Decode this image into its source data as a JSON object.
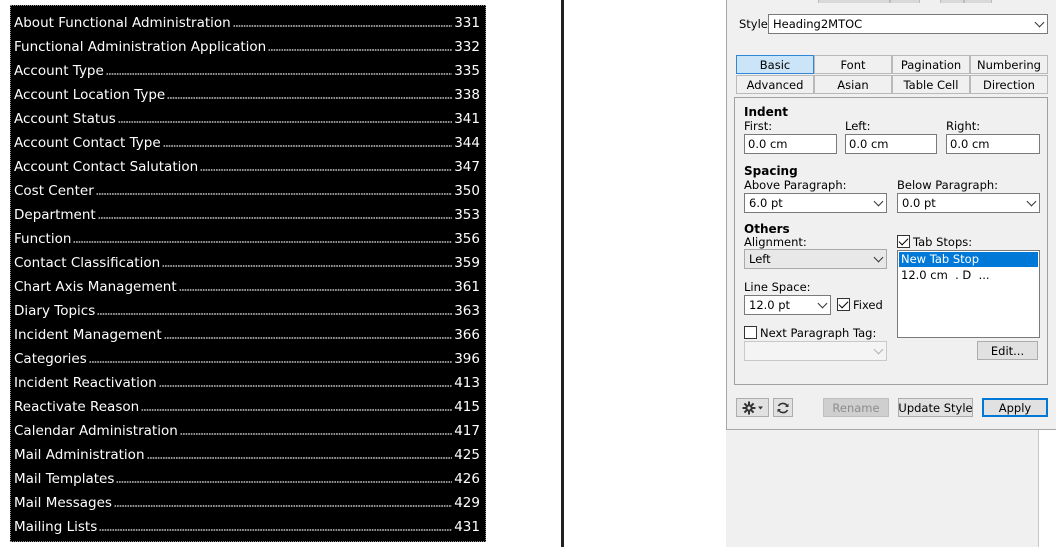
{
  "toc": {
    "entries": [
      {
        "title": "About Functional Administration",
        "page": "331"
      },
      {
        "title": "Functional Administration Application",
        "page": "332"
      },
      {
        "title": "Account Type",
        "page": "335"
      },
      {
        "title": "Account Location Type",
        "page": "338"
      },
      {
        "title": "Account Status",
        "page": "341"
      },
      {
        "title": "Account Contact Type",
        "page": "344"
      },
      {
        "title": "Account Contact Salutation",
        "page": "347"
      },
      {
        "title": "Cost Center",
        "page": "350"
      },
      {
        "title": "Department",
        "page": "353"
      },
      {
        "title": "Function",
        "page": "356"
      },
      {
        "title": "Contact Classification",
        "page": "359"
      },
      {
        "title": "Chart Axis Management",
        "page": "361"
      },
      {
        "title": "Diary Topics",
        "page": "363"
      },
      {
        "title": "Incident Management",
        "page": "366"
      },
      {
        "title": "Categories",
        "page": "396"
      },
      {
        "title": "Incident Reactivation",
        "page": "413"
      },
      {
        "title": "Reactivate Reason",
        "page": "415"
      },
      {
        "title": "Calendar Administration",
        "page": "417"
      },
      {
        "title": "Mail Administration",
        "page": "425"
      },
      {
        "title": "Mail Templates",
        "page": "426"
      },
      {
        "title": "Mail Messages",
        "page": "429"
      },
      {
        "title": "Mailing Lists",
        "page": "431"
      }
    ]
  },
  "designer": {
    "style_label": "Style:",
    "style_value": "Heading2MTOC",
    "tabs": [
      "Basic",
      "Font",
      "Pagination",
      "Numbering",
      "Advanced",
      "Asian",
      "Table Cell",
      "Direction"
    ],
    "active_tab": "Basic",
    "indent": {
      "heading": "Indent",
      "first_label": "First:",
      "first_value": "0.0 cm",
      "left_label": "Left:",
      "left_value": "0.0 cm",
      "right_label": "Right:",
      "right_value": "0.0 cm"
    },
    "spacing": {
      "heading": "Spacing",
      "above_label": "Above Paragraph:",
      "above_value": "6.0 pt",
      "below_label": "Below Paragraph:",
      "below_value": "0.0 pt"
    },
    "others": {
      "heading": "Others",
      "alignment_label": "Alignment:",
      "alignment_value": "Left",
      "line_space_label": "Line Space:",
      "line_space_value": "12.0 pt",
      "fixed_label": "Fixed",
      "fixed_checked": true,
      "next_tag_label": "Next Paragraph Tag:",
      "next_tag_checked": false,
      "next_tag_value": ""
    },
    "tab_stops": {
      "label": "Tab Stops:",
      "checked": true,
      "items": [
        "New Tab Stop",
        "12.0 cm  . D  ..."
      ],
      "selected_index": 0,
      "edit_label": "Edit..."
    },
    "footer": {
      "settings_icon": "gear-icon",
      "refresh_icon": "refresh-icon",
      "rename_label": "Rename",
      "update_style_label": "Update Style",
      "apply_label": "Apply"
    },
    "colors": {
      "selection": "#0078d7",
      "active_tab_bg": "#cce4f7",
      "panel_bg": "#f0f0f0"
    }
  }
}
